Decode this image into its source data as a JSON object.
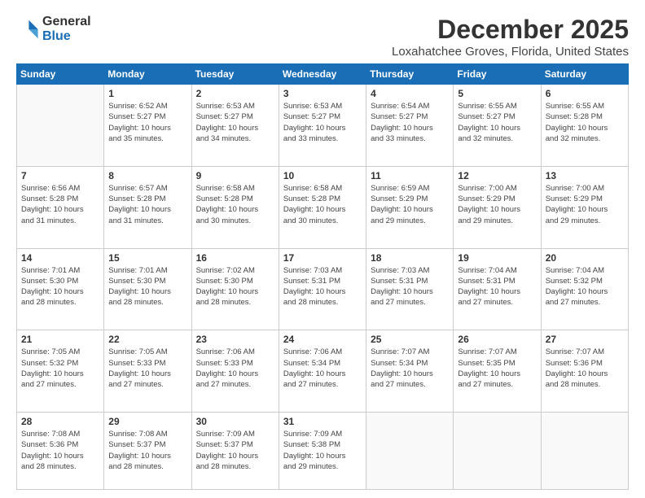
{
  "logo": {
    "line1": "General",
    "line2": "Blue"
  },
  "title": "December 2025",
  "subtitle": "Loxahatchee Groves, Florida, United States",
  "days_header": [
    "Sunday",
    "Monday",
    "Tuesday",
    "Wednesday",
    "Thursday",
    "Friday",
    "Saturday"
  ],
  "weeks": [
    [
      {
        "num": "",
        "info": ""
      },
      {
        "num": "1",
        "info": "Sunrise: 6:52 AM\nSunset: 5:27 PM\nDaylight: 10 hours\nand 35 minutes."
      },
      {
        "num": "2",
        "info": "Sunrise: 6:53 AM\nSunset: 5:27 PM\nDaylight: 10 hours\nand 34 minutes."
      },
      {
        "num": "3",
        "info": "Sunrise: 6:53 AM\nSunset: 5:27 PM\nDaylight: 10 hours\nand 33 minutes."
      },
      {
        "num": "4",
        "info": "Sunrise: 6:54 AM\nSunset: 5:27 PM\nDaylight: 10 hours\nand 33 minutes."
      },
      {
        "num": "5",
        "info": "Sunrise: 6:55 AM\nSunset: 5:27 PM\nDaylight: 10 hours\nand 32 minutes."
      },
      {
        "num": "6",
        "info": "Sunrise: 6:55 AM\nSunset: 5:28 PM\nDaylight: 10 hours\nand 32 minutes."
      }
    ],
    [
      {
        "num": "7",
        "info": "Sunrise: 6:56 AM\nSunset: 5:28 PM\nDaylight: 10 hours\nand 31 minutes."
      },
      {
        "num": "8",
        "info": "Sunrise: 6:57 AM\nSunset: 5:28 PM\nDaylight: 10 hours\nand 31 minutes."
      },
      {
        "num": "9",
        "info": "Sunrise: 6:58 AM\nSunset: 5:28 PM\nDaylight: 10 hours\nand 30 minutes."
      },
      {
        "num": "10",
        "info": "Sunrise: 6:58 AM\nSunset: 5:28 PM\nDaylight: 10 hours\nand 30 minutes."
      },
      {
        "num": "11",
        "info": "Sunrise: 6:59 AM\nSunset: 5:29 PM\nDaylight: 10 hours\nand 29 minutes."
      },
      {
        "num": "12",
        "info": "Sunrise: 7:00 AM\nSunset: 5:29 PM\nDaylight: 10 hours\nand 29 minutes."
      },
      {
        "num": "13",
        "info": "Sunrise: 7:00 AM\nSunset: 5:29 PM\nDaylight: 10 hours\nand 29 minutes."
      }
    ],
    [
      {
        "num": "14",
        "info": "Sunrise: 7:01 AM\nSunset: 5:30 PM\nDaylight: 10 hours\nand 28 minutes."
      },
      {
        "num": "15",
        "info": "Sunrise: 7:01 AM\nSunset: 5:30 PM\nDaylight: 10 hours\nand 28 minutes."
      },
      {
        "num": "16",
        "info": "Sunrise: 7:02 AM\nSunset: 5:30 PM\nDaylight: 10 hours\nand 28 minutes."
      },
      {
        "num": "17",
        "info": "Sunrise: 7:03 AM\nSunset: 5:31 PM\nDaylight: 10 hours\nand 28 minutes."
      },
      {
        "num": "18",
        "info": "Sunrise: 7:03 AM\nSunset: 5:31 PM\nDaylight: 10 hours\nand 27 minutes."
      },
      {
        "num": "19",
        "info": "Sunrise: 7:04 AM\nSunset: 5:31 PM\nDaylight: 10 hours\nand 27 minutes."
      },
      {
        "num": "20",
        "info": "Sunrise: 7:04 AM\nSunset: 5:32 PM\nDaylight: 10 hours\nand 27 minutes."
      }
    ],
    [
      {
        "num": "21",
        "info": "Sunrise: 7:05 AM\nSunset: 5:32 PM\nDaylight: 10 hours\nand 27 minutes."
      },
      {
        "num": "22",
        "info": "Sunrise: 7:05 AM\nSunset: 5:33 PM\nDaylight: 10 hours\nand 27 minutes."
      },
      {
        "num": "23",
        "info": "Sunrise: 7:06 AM\nSunset: 5:33 PM\nDaylight: 10 hours\nand 27 minutes."
      },
      {
        "num": "24",
        "info": "Sunrise: 7:06 AM\nSunset: 5:34 PM\nDaylight: 10 hours\nand 27 minutes."
      },
      {
        "num": "25",
        "info": "Sunrise: 7:07 AM\nSunset: 5:34 PM\nDaylight: 10 hours\nand 27 minutes."
      },
      {
        "num": "26",
        "info": "Sunrise: 7:07 AM\nSunset: 5:35 PM\nDaylight: 10 hours\nand 27 minutes."
      },
      {
        "num": "27",
        "info": "Sunrise: 7:07 AM\nSunset: 5:36 PM\nDaylight: 10 hours\nand 28 minutes."
      }
    ],
    [
      {
        "num": "28",
        "info": "Sunrise: 7:08 AM\nSunset: 5:36 PM\nDaylight: 10 hours\nand 28 minutes."
      },
      {
        "num": "29",
        "info": "Sunrise: 7:08 AM\nSunset: 5:37 PM\nDaylight: 10 hours\nand 28 minutes."
      },
      {
        "num": "30",
        "info": "Sunrise: 7:09 AM\nSunset: 5:37 PM\nDaylight: 10 hours\nand 28 minutes."
      },
      {
        "num": "31",
        "info": "Sunrise: 7:09 AM\nSunset: 5:38 PM\nDaylight: 10 hours\nand 29 minutes."
      },
      {
        "num": "",
        "info": ""
      },
      {
        "num": "",
        "info": ""
      },
      {
        "num": "",
        "info": ""
      }
    ]
  ]
}
